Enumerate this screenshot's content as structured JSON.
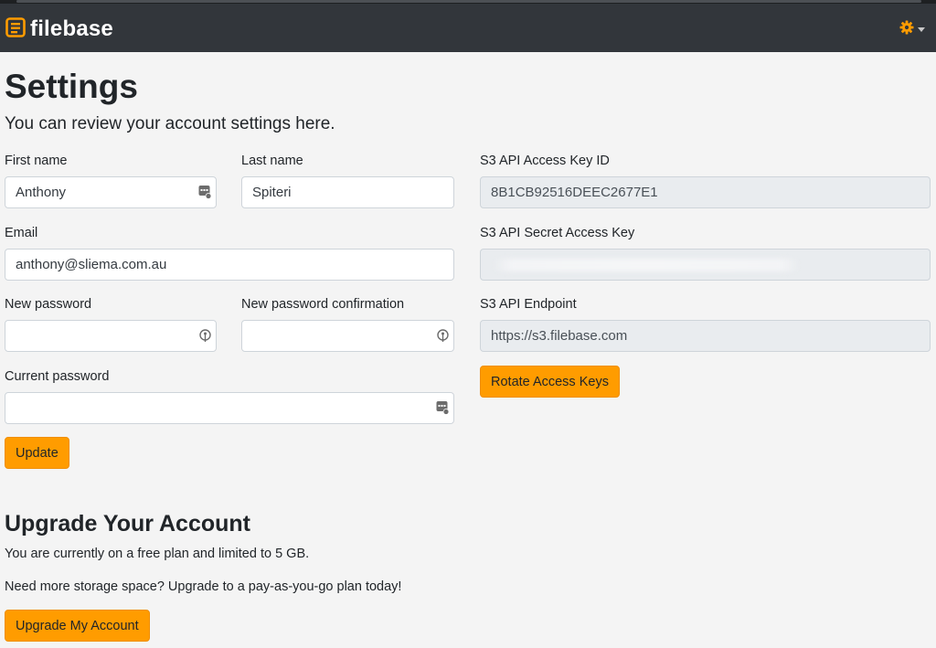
{
  "header": {
    "brand": "filebase",
    "accent": "#ff9c00",
    "background": "#32363b",
    "icons": [
      "filebase-logo-icon",
      "gear-icon",
      "caret-down-icon"
    ]
  },
  "page": {
    "title": "Settings",
    "subtitle": "You can review your account settings here."
  },
  "form": {
    "first_name_label": "First name",
    "first_name_value": "Anthony",
    "last_name_label": "Last name",
    "last_name_value": "Spiteri",
    "email_label": "Email",
    "email_value": "anthony@sliema.com.au",
    "new_password_label": "New password",
    "new_password_confirmation_label": "New password confirmation",
    "current_password_label": "Current password",
    "update_button": "Update"
  },
  "api": {
    "access_key_label": "S3 API Access Key ID",
    "access_key_value": "8B1CB92516DEEC2677E1",
    "secret_key_label": "S3 API Secret Access Key",
    "endpoint_label": "S3 API Endpoint",
    "endpoint_value": "https://s3.filebase.com",
    "rotate_button": "Rotate Access Keys"
  },
  "upgrade": {
    "title": "Upgrade Your Account",
    "plan_text": "You are currently on a free plan and limited to 5 GB.",
    "cta_text": "Need more storage space? Upgrade to a pay-as-you-go plan today!",
    "button": "Upgrade My Account"
  }
}
